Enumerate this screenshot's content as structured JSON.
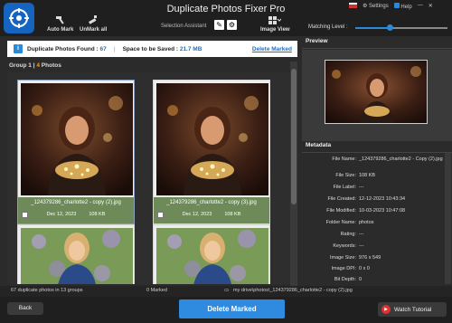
{
  "app": {
    "title": "Duplicate Photos Fixer Pro"
  },
  "toolbar": {
    "auto_mark": "Auto Mark",
    "unmark_all": "UnMark all",
    "selection_assistant": "Selection Assistant",
    "image_view": "Image View"
  },
  "top_right": {
    "settings": "Settings",
    "help": "Help"
  },
  "matching_level": {
    "label": "Matching Level :",
    "value": 0.38
  },
  "info_bar": {
    "found_label": "Duplicate Photos Found :",
    "found_value": "67",
    "space_label": "Space to be Saved :",
    "space_value": "21.7 MB",
    "delete_link": "Delete Marked"
  },
  "group": {
    "prefix": "Group 1 |",
    "count": "4",
    "suffix": "Photos"
  },
  "photos": [
    {
      "name": "_124379286_charlotte2 - copy (2).jpg",
      "date": "Dec 12, 2023",
      "size": "108 KB"
    },
    {
      "name": "_124379286_charlotte2 - copy (3).jpg",
      "date": "Dec 12, 2023",
      "size": "108 KB"
    }
  ],
  "panels": {
    "preview": "Preview",
    "metadata": "Metadata"
  },
  "metadata": [
    {
      "key": "File Name:",
      "value": "_124379286_charlotte2 - Copy (2).jpg"
    },
    {
      "key": "File Size:",
      "value": "108 KB"
    },
    {
      "key": "File Label:",
      "value": "---"
    },
    {
      "key": "File Created:",
      "value": "12-12-2023 10:43:34"
    },
    {
      "key": "File Modified:",
      "value": "10-03-2023 10:47:08"
    },
    {
      "key": "Folder Name:",
      "value": "photos"
    },
    {
      "key": "Rating:",
      "value": "---"
    },
    {
      "key": "Keywords:",
      "value": "---"
    },
    {
      "key": "Image Size:",
      "value": "976 x 549"
    },
    {
      "key": "Image DPI:",
      "value": "0 x 0"
    },
    {
      "key": "Bit Depth:",
      "value": "0"
    }
  ],
  "status": {
    "summary": "67 duplicate photos in 13 groups",
    "marked": "0 Marked",
    "path": "my drive\\photos\\_124379286_charlotte2 - copy (2).jpg"
  },
  "bottom": {
    "back": "Back",
    "delete": "Delete Marked",
    "tutorial": "Watch Tutorial"
  },
  "colors": {
    "accent": "#2e8be0",
    "caption_green": "#6e8a58",
    "count_orange": "#f0a020"
  }
}
